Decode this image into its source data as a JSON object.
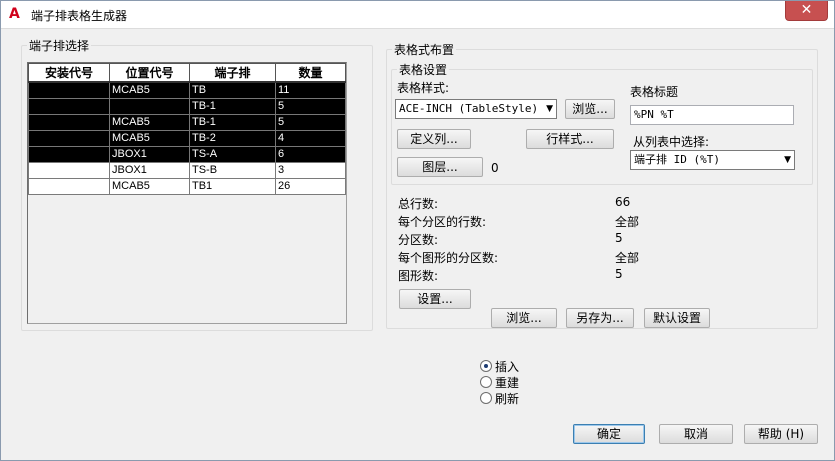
{
  "window": {
    "title": "端子排表格生成器",
    "close_glyph": "✕",
    "app_icon_glyph": "A"
  },
  "left_group": {
    "legend": "端子排选择",
    "columns": [
      "安装代号",
      "位置代号",
      "端子排",
      "数量"
    ],
    "rows": [
      {
        "install": "",
        "location": "MCAB5",
        "strip": "TB",
        "count": "11",
        "selected": true
      },
      {
        "install": "",
        "location": "",
        "strip": "TB-1",
        "count": "5",
        "selected": true
      },
      {
        "install": "",
        "location": "MCAB5",
        "strip": "TB-1",
        "count": "5",
        "selected": true
      },
      {
        "install": "",
        "location": "MCAB5",
        "strip": "TB-2",
        "count": "4",
        "selected": true
      },
      {
        "install": "",
        "location": "JBOX1",
        "strip": "TS-A",
        "count": "6",
        "selected": true
      },
      {
        "install": "",
        "location": "JBOX1",
        "strip": "TS-B",
        "count": "3",
        "selected": false
      },
      {
        "install": "",
        "location": "MCAB5",
        "strip": "TB1",
        "count": "26",
        "selected": false
      }
    ]
  },
  "right_group": {
    "legend": "表格式布置",
    "settings": {
      "legend": "表格设置",
      "style_label": "表格样式:",
      "style_value": "ACE-INCH (TableStyle)",
      "browse_label": "浏览...",
      "define_columns_label": "定义列...",
      "row_style_label": "行样式...",
      "layer_label": "图层...",
      "layer_value": "0"
    },
    "title_section": {
      "label": "表格标题",
      "value": "%PN %T",
      "from_column_label": "从列表中选择:",
      "from_column_value": "端子排 ID (%T)"
    },
    "stats": [
      {
        "label": "总行数:",
        "value": "66"
      },
      {
        "label": "每个分区的行数:",
        "value": "全部"
      },
      {
        "label": "分区数:",
        "value": "5"
      },
      {
        "label": "每个图形的分区数:",
        "value": "全部"
      },
      {
        "label": "图形数:",
        "value": "5"
      }
    ],
    "setup_label": "设置...",
    "browse_label": "浏览...",
    "save_as_label": "另存为...",
    "defaults_label": "默认设置"
  },
  "mode_options": [
    {
      "label": "插入",
      "checked": true
    },
    {
      "label": "重建",
      "checked": false
    },
    {
      "label": "刷新",
      "checked": false
    }
  ],
  "footer": {
    "ok_label": "确定",
    "cancel_label": "取消",
    "help_label": "帮助 (H)"
  },
  "icons": {
    "dropdown": "chevron-down-icon",
    "app": "autocad-logo-icon",
    "close": "close-icon"
  },
  "colors": {
    "selected_row_bg": "#000000",
    "close_button": "#c75050",
    "brand_red": "#d0021b"
  }
}
